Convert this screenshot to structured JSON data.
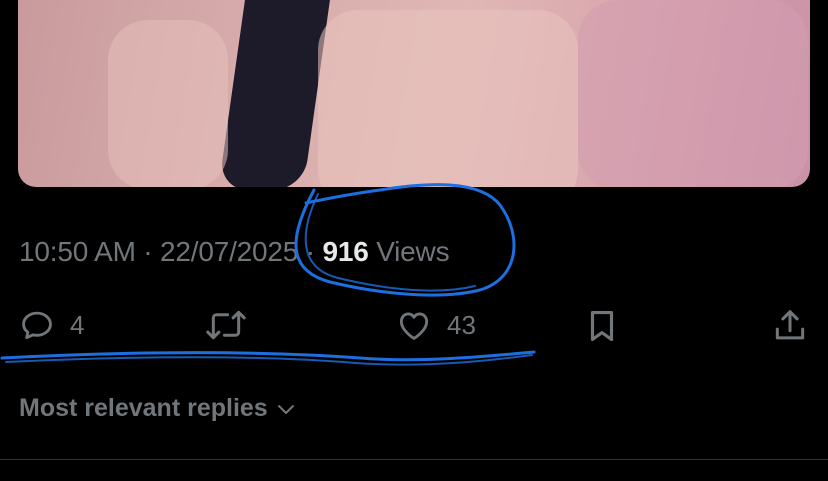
{
  "tweet": {
    "time": "10:50 AM",
    "separator": "·",
    "date": "22/07/2025",
    "views_count": "916",
    "views_label": "Views"
  },
  "actions": {
    "reply_count": "4",
    "like_count": "43"
  },
  "replies": {
    "sort_label": "Most relevant replies"
  },
  "colors": {
    "background": "#000000",
    "muted_text": "#71767b",
    "primary_text": "#e7e9ea",
    "annotation": "#1d6fe0"
  },
  "icons": [
    "reply-icon",
    "retweet-icon",
    "like-icon",
    "bookmark-icon",
    "share-icon",
    "chevron-down-icon"
  ]
}
